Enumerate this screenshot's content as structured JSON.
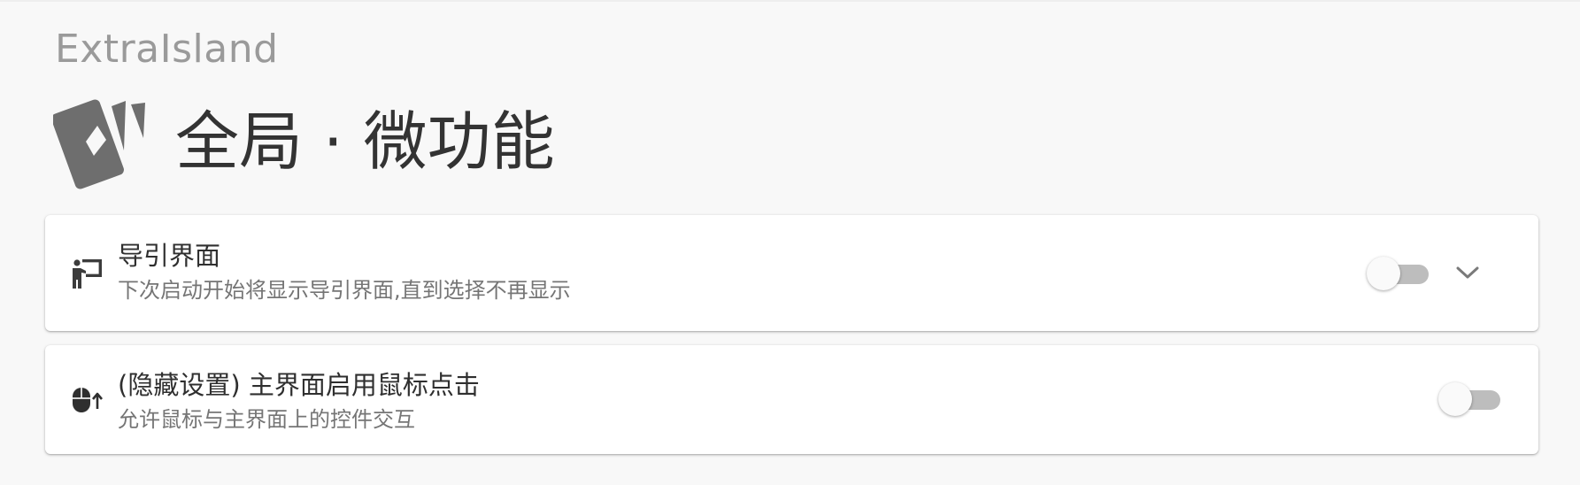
{
  "app": {
    "name": "ExtraIsland"
  },
  "header": {
    "title": "全局 · 微功能",
    "logo_icon": "cards-logo-icon"
  },
  "settings": [
    {
      "icon": "presenter-board-icon",
      "title": "导引界面",
      "subtitle": "下次启动开始将显示导引界面,直到选择不再显示",
      "enabled": false,
      "expandable": true,
      "expand_icon": "chevron-down-icon"
    },
    {
      "icon": "mouse-up-icon",
      "title": "(隐藏设置) 主界面启用鼠标点击",
      "subtitle": "允许鼠标与主界面上的控件交互",
      "enabled": false,
      "expandable": false
    }
  ],
  "colors": {
    "background": "#f8f8f8",
    "card": "#ffffff",
    "title_text": "#333333",
    "app_name_text": "#9a9a9a",
    "subtitle_text": "#757575",
    "toggle_track_off": "#bdbdbd",
    "toggle_knob": "#fafafa",
    "icon": "#6e6e6e"
  }
}
